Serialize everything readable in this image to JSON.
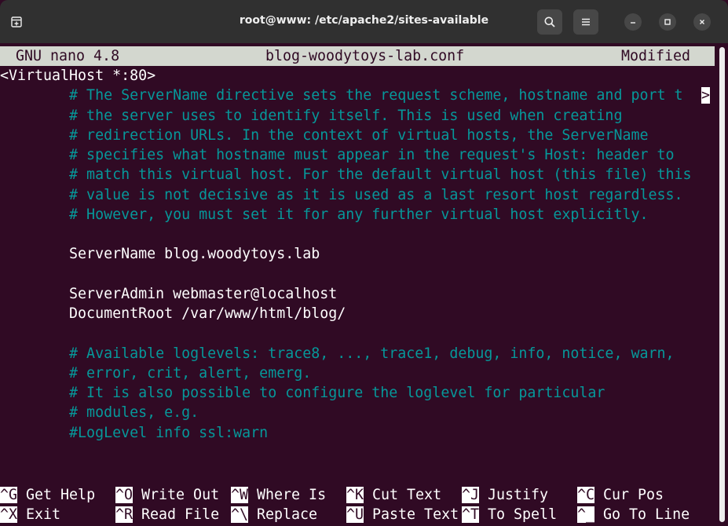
{
  "window": {
    "title": "root@www: /etc/apache2/sites-available",
    "buttons": [
      "new-tab",
      "search",
      "menu",
      "minimize",
      "maximize",
      "close"
    ]
  },
  "nano": {
    "version": "GNU nano 4.8",
    "filename": "blog-woodytoys-lab.conf",
    "status": "Modified"
  },
  "file_lines": [
    {
      "text": "<VirtualHost *:80>",
      "type": "code"
    },
    {
      "text": "        # The ServerName directive sets the request scheme, hostname and port t",
      "type": "comment"
    },
    {
      "text": "        # the server uses to identify itself. This is used when creating",
      "type": "comment"
    },
    {
      "text": "        # redirection URLs. In the context of virtual hosts, the ServerName",
      "type": "comment"
    },
    {
      "text": "        # specifies what hostname must appear in the request's Host: header to",
      "type": "comment"
    },
    {
      "text": "        # match this virtual host. For the default virtual host (this file) this",
      "type": "comment"
    },
    {
      "text": "        # value is not decisive as it is used as a last resort host regardless.",
      "type": "comment"
    },
    {
      "text": "        # However, you must set it for any further virtual host explicitly.",
      "type": "comment"
    },
    {
      "text": "",
      "type": "code"
    },
    {
      "text": "        ServerName blog.woodytoys.lab",
      "type": "code"
    },
    {
      "text": "",
      "type": "code"
    },
    {
      "text": "        ServerAdmin webmaster@localhost",
      "type": "code"
    },
    {
      "text": "        DocumentRoot /var/www/html/blog/",
      "type": "code"
    },
    {
      "text": "",
      "type": "code"
    },
    {
      "text": "        # Available loglevels: trace8, ..., trace1, debug, info, notice, warn,",
      "type": "comment"
    },
    {
      "text": "        # error, crit, alert, emerg.",
      "type": "comment"
    },
    {
      "text": "        # It is also possible to configure the loglevel for particular",
      "type": "comment"
    },
    {
      "text": "        # modules, e.g.",
      "type": "comment"
    },
    {
      "text": "        #LogLevel info ssl:warn",
      "type": "comment"
    }
  ],
  "overflow_marker": ">",
  "shortcuts": [
    {
      "key": "^G",
      "label": " Get Help"
    },
    {
      "key": "^O",
      "label": " Write Out"
    },
    {
      "key": "^W",
      "label": " Where Is"
    },
    {
      "key": "^K",
      "label": " Cut Text"
    },
    {
      "key": "^J",
      "label": " Justify"
    },
    {
      "key": "^C",
      "label": " Cur Pos"
    },
    {
      "key": "^X",
      "label": " Exit"
    },
    {
      "key": "^R",
      "label": " Read File"
    },
    {
      "key": "^\\",
      "label": " Replace"
    },
    {
      "key": "^U",
      "label": " Paste Text"
    },
    {
      "key": "^T",
      "label": " To Spell"
    },
    {
      "key": "^_",
      "label": " Go To Line"
    }
  ]
}
